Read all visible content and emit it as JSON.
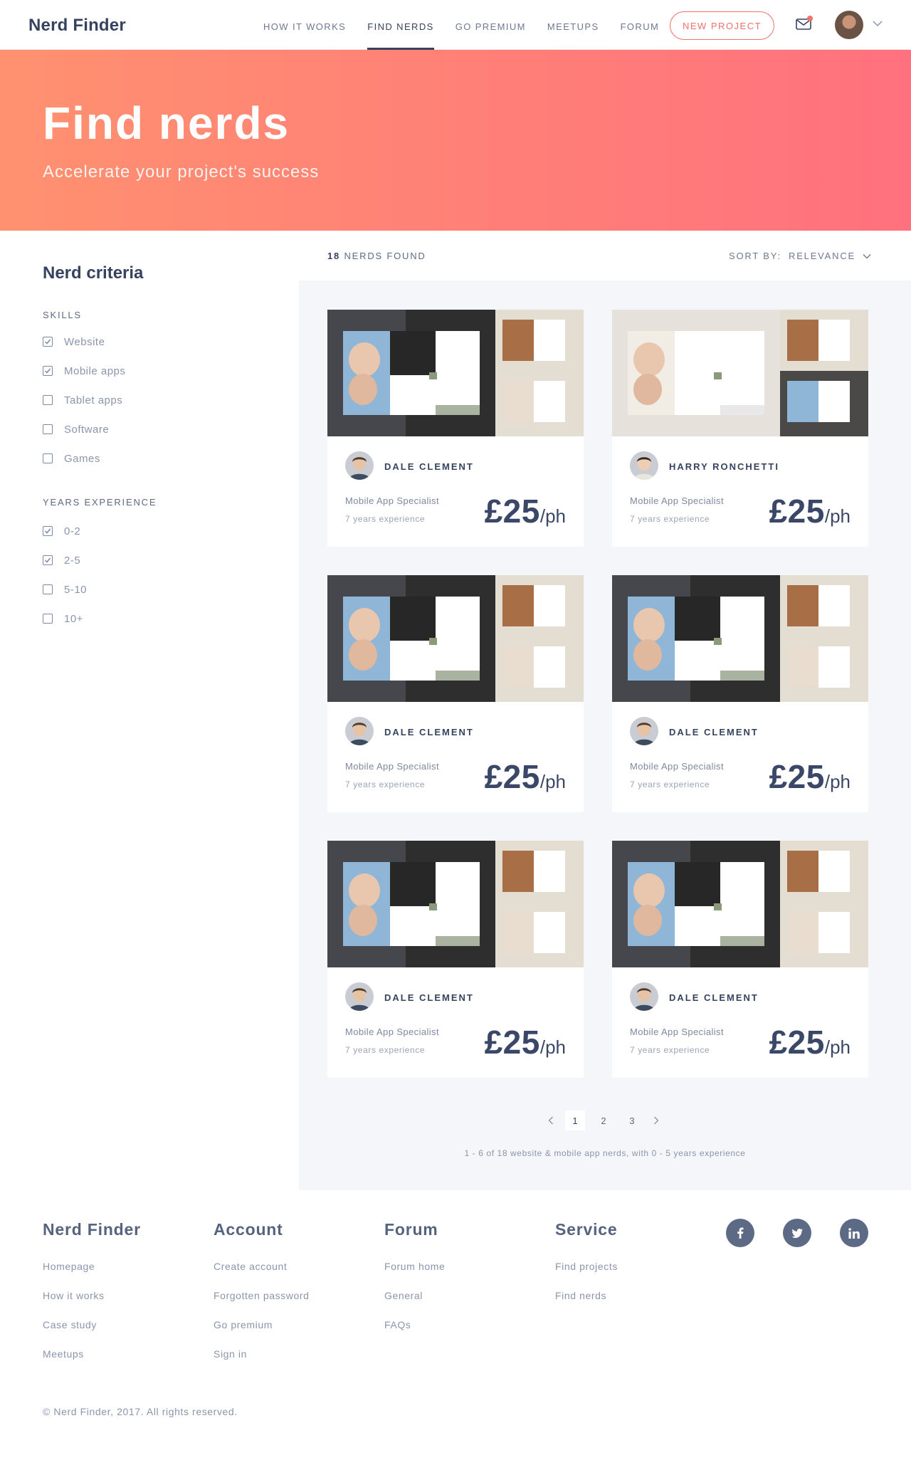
{
  "header": {
    "logo": "Nerd Finder",
    "nav": [
      "HOW IT WORKS",
      "FIND NERDS",
      "GO PREMIUM",
      "MEETUPS",
      "FORUM"
    ],
    "active_nav": "FIND NERDS",
    "cta": "NEW PROJECT",
    "icons": [
      "mail-icon",
      "notification-dot",
      "avatar",
      "chevron-down-icon"
    ]
  },
  "hero": {
    "title": "Find nerds",
    "subtitle": "Accelerate your project's success"
  },
  "filters": {
    "title": "Nerd criteria",
    "skills": {
      "heading": "SKILLS",
      "items": [
        {
          "label": "Website",
          "checked": true
        },
        {
          "label": "Mobile apps",
          "checked": true
        },
        {
          "label": "Tablet apps",
          "checked": false
        },
        {
          "label": "Software",
          "checked": false
        },
        {
          "label": "Games",
          "checked": false
        }
      ]
    },
    "experience": {
      "heading": "YEARS EXPERIENCE",
      "items": [
        {
          "label": "0-2",
          "checked": true
        },
        {
          "label": "2-5",
          "checked": true
        },
        {
          "label": "5-10",
          "checked": false
        },
        {
          "label": "10+",
          "checked": false
        }
      ]
    }
  },
  "results": {
    "count": "18",
    "count_label": "NERDS FOUND",
    "sort_label": "SORT BY:",
    "sort_value": "RELEVANCE",
    "summary": "1 - 6 of 18 website & mobile app nerds, with 0 - 5 years experience"
  },
  "cards": [
    {
      "name": "DALE CLEMENT",
      "role": "Mobile App Specialist",
      "experience": "7 years experience",
      "price": "£25",
      "unit": "/ph"
    },
    {
      "name": "HARRY RONCHETTI",
      "role": "Mobile App Specialist",
      "experience": "7 years experience",
      "price": "£25",
      "unit": "/ph"
    },
    {
      "name": "DALE CLEMENT",
      "role": "Mobile App Specialist",
      "experience": "7 years experience",
      "price": "£25",
      "unit": "/ph"
    },
    {
      "name": "DALE CLEMENT",
      "role": "Mobile App Specialist",
      "experience": "7 years experience",
      "price": "£25",
      "unit": "/ph"
    },
    {
      "name": "DALE CLEMENT",
      "role": "Mobile App Specialist",
      "experience": "7 years experience",
      "price": "£25",
      "unit": "/ph"
    },
    {
      "name": "DALE CLEMENT",
      "role": "Mobile App Specialist",
      "experience": "7 years experience",
      "price": "£25",
      "unit": "/ph"
    }
  ],
  "pagination": {
    "pages": [
      "1",
      "2",
      "3"
    ],
    "current": "1"
  },
  "footer": {
    "columns": [
      {
        "title": "Nerd Finder",
        "links": [
          "Homepage",
          "How it works",
          "Case study",
          "Meetups"
        ]
      },
      {
        "title": "Account",
        "links": [
          "Create account",
          "Forgotten password",
          "Go premium",
          "Sign in"
        ]
      },
      {
        "title": "Forum",
        "links": [
          "Forum home",
          "General",
          "FAQs"
        ]
      },
      {
        "title": "Service",
        "links": [
          "Find projects",
          "Find nerds"
        ]
      }
    ],
    "social": [
      "facebook-icon",
      "twitter-icon",
      "linkedin-icon"
    ],
    "copyright": "© Nerd Finder, 2017. All rights reserved."
  },
  "colors": {
    "accent": "#f0706c",
    "hero_start": "#ff9170",
    "hero_end": "#ff717e",
    "text_dark": "#36435f",
    "social_bg": "#5d6a85"
  }
}
